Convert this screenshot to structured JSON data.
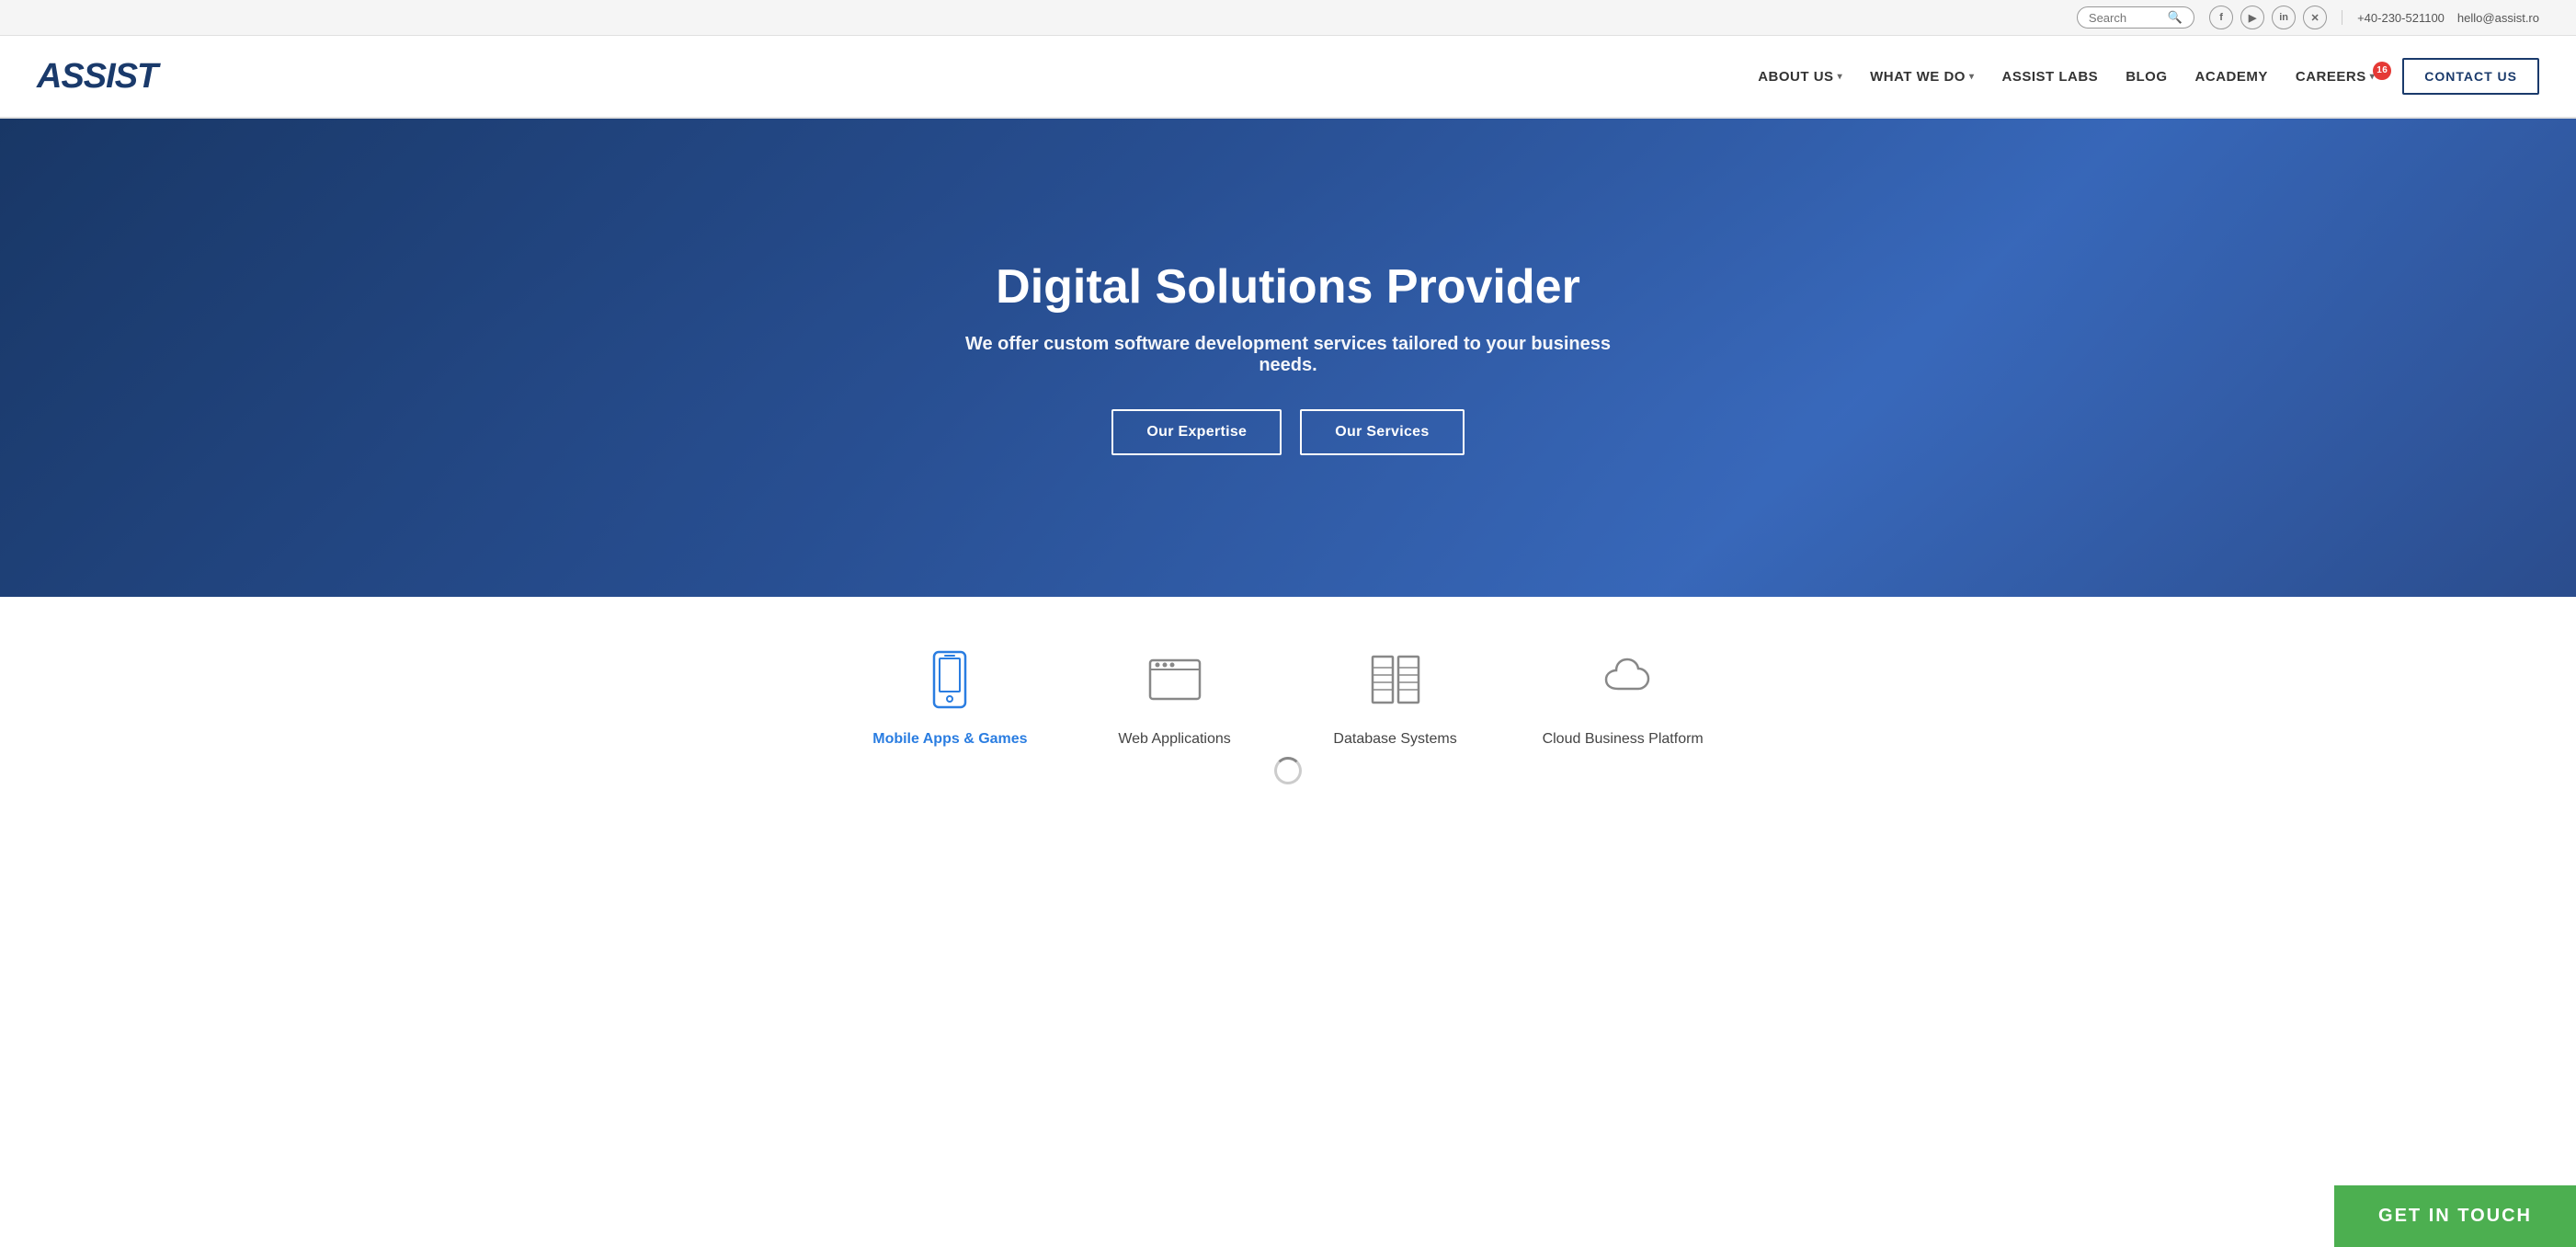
{
  "topbar": {
    "search_placeholder": "Search",
    "search_icon": "🔍",
    "social": [
      {
        "name": "facebook-icon",
        "label": "f"
      },
      {
        "name": "youtube-icon",
        "label": "▶"
      },
      {
        "name": "linkedin-icon",
        "label": "in"
      },
      {
        "name": "xing-icon",
        "label": "x"
      }
    ],
    "phone": "+40-230-521100",
    "email": "hello@assist.ro"
  },
  "navbar": {
    "logo": "ASSIST",
    "nav_items": [
      {
        "label": "ABOUT US",
        "has_dropdown": true,
        "name": "about-us"
      },
      {
        "label": "WHAT WE DO",
        "has_dropdown": true,
        "name": "what-we-do"
      },
      {
        "label": "ASSIST LABS",
        "has_dropdown": false,
        "name": "assist-labs"
      },
      {
        "label": "BLOG",
        "has_dropdown": false,
        "name": "blog"
      },
      {
        "label": "ACADEMY",
        "has_dropdown": false,
        "name": "academy"
      },
      {
        "label": "CAREERS",
        "has_dropdown": true,
        "name": "careers",
        "badge": "16"
      }
    ],
    "contact_btn": "CONTACT US"
  },
  "hero": {
    "title": "Digital Solutions Provider",
    "subtitle": "We offer custom software development services tailored to your business needs.",
    "btn1": "Our Expertise",
    "btn2": "Our Services"
  },
  "services": [
    {
      "label": "Mobile Apps & Games",
      "active": true,
      "icon": "mobile",
      "name": "mobile-apps"
    },
    {
      "label": "Web Applications",
      "active": false,
      "icon": "web",
      "name": "web-apps"
    },
    {
      "label": "Database Systems",
      "active": false,
      "icon": "database",
      "name": "database-systems"
    },
    {
      "label": "Cloud Business Platform",
      "active": false,
      "icon": "cloud",
      "name": "cloud-platform"
    }
  ],
  "cta": {
    "label": "GET IN TOUCH"
  }
}
